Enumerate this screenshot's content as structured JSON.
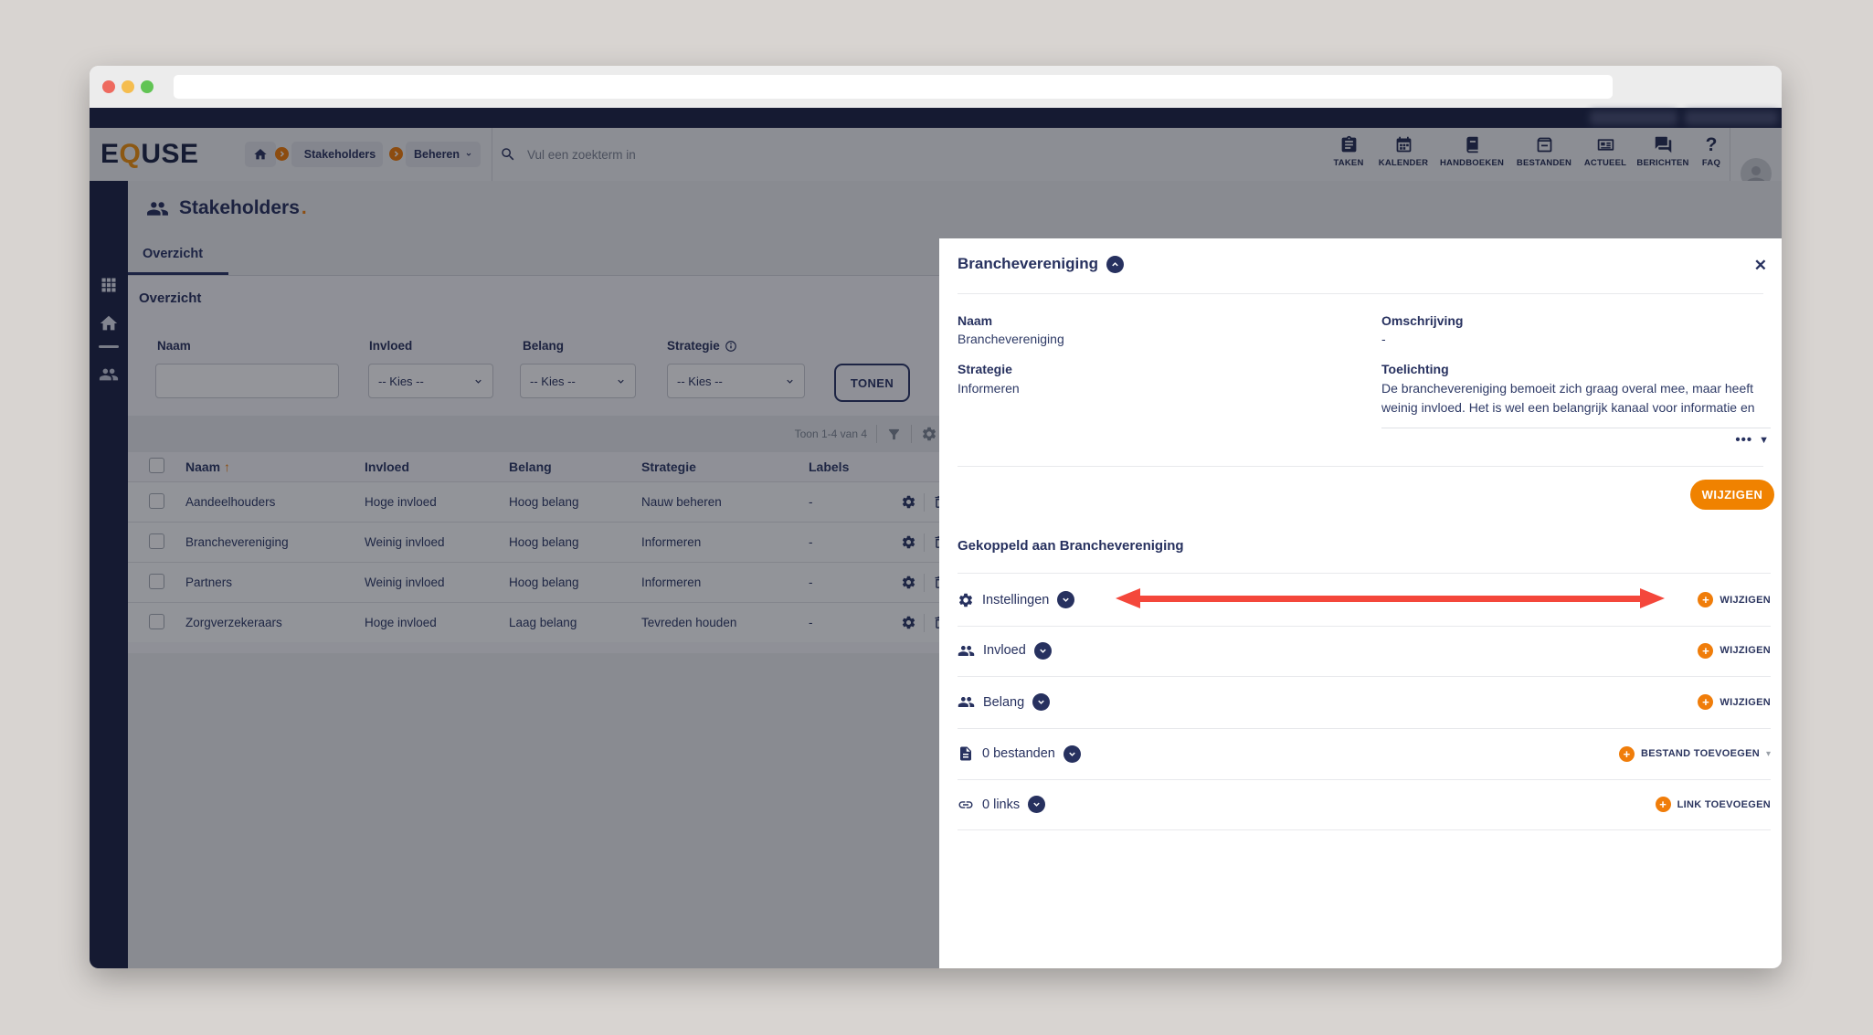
{
  "colors": {
    "accent_orange": "#f08200",
    "navy": "#2b355f",
    "arrow_red": "#f4473b",
    "sidebar_navy": "#1d2547"
  },
  "browser": {
    "url": ""
  },
  "header": {
    "logo_pre": "E",
    "logo_q": "Q",
    "logo_post": "USE",
    "breadcrumb": {
      "stakeholders": "Stakeholders",
      "beheren": "Beheren"
    },
    "search_placeholder": "Vul een zoekterm in",
    "nav": [
      {
        "label": "TAKEN"
      },
      {
        "label": "KALENDER"
      },
      {
        "label": "HANDBOEKEN"
      },
      {
        "label": "BESTANDEN"
      },
      {
        "label": "ACTUEEL"
      },
      {
        "label": "BERICHTEN"
      },
      {
        "label": "FAQ"
      }
    ]
  },
  "page": {
    "title": "Stakeholders",
    "title_dot": ".",
    "tab": "Overzicht",
    "section_title": "Overzicht",
    "filters": {
      "naam_label": "Naam",
      "invloed_label": "Invloed",
      "belang_label": "Belang",
      "strategie_label": "Strategie",
      "kies_placeholder": "-- Kies --",
      "tonen_label": "TONEN"
    },
    "toolbar": {
      "count_text": "Toon 1-4 van 4"
    },
    "table": {
      "headers": {
        "naam": "Naam",
        "invloed": "Invloed",
        "belang": "Belang",
        "strategie": "Strategie",
        "labels": "Labels"
      },
      "rows": [
        {
          "naam": "Aandeelhouders",
          "invloed": "Hoge invloed",
          "belang": "Hoog belang",
          "strategie": "Nauw beheren",
          "labels": "-"
        },
        {
          "naam": "Branchevereniging",
          "invloed": "Weinig invloed",
          "belang": "Hoog belang",
          "strategie": "Informeren",
          "labels": "-"
        },
        {
          "naam": "Partners",
          "invloed": "Weinig invloed",
          "belang": "Hoog belang",
          "strategie": "Informeren",
          "labels": "-"
        },
        {
          "naam": "Zorgverzekeraars",
          "invloed": "Hoge invloed",
          "belang": "Laag belang",
          "strategie": "Tevreden houden",
          "labels": "-"
        }
      ]
    }
  },
  "modal": {
    "title": "Branchevereniging",
    "fields": {
      "naam_label": "Naam",
      "naam_value": "Branchevereniging",
      "omschrijving_label": "Omschrijving",
      "omschrijving_value": "-",
      "strategie_label": "Strategie",
      "strategie_value": "Informeren",
      "toelichting_label": "Toelichting",
      "toelichting_line1": "De branchevereniging bemoeit zich graag overal mee, maar heeft",
      "toelichting_line2": "weinig invloed. Het is wel een belangrijk kanaal voor informatie en"
    },
    "expand_dots": "•••",
    "wijzigen_button": "WIJZIGEN",
    "linked_title": "Gekoppeld aan Branchevereniging",
    "rows": [
      {
        "label": "Instellingen",
        "action": "WIJZIGEN"
      },
      {
        "label": "Invloed",
        "action": "WIJZIGEN"
      },
      {
        "label": "Belang",
        "action": "WIJZIGEN"
      },
      {
        "label": "0 bestanden",
        "action": "BESTAND TOEVOEGEN"
      },
      {
        "label": "0 links",
        "action": "LINK TOEVOEGEN"
      }
    ]
  },
  "icons": {
    "close": "✕",
    "sort_asc": "↑",
    "expand_caret": "▼",
    "dropdown_caret": "▾",
    "question": "?",
    "help": "?"
  }
}
